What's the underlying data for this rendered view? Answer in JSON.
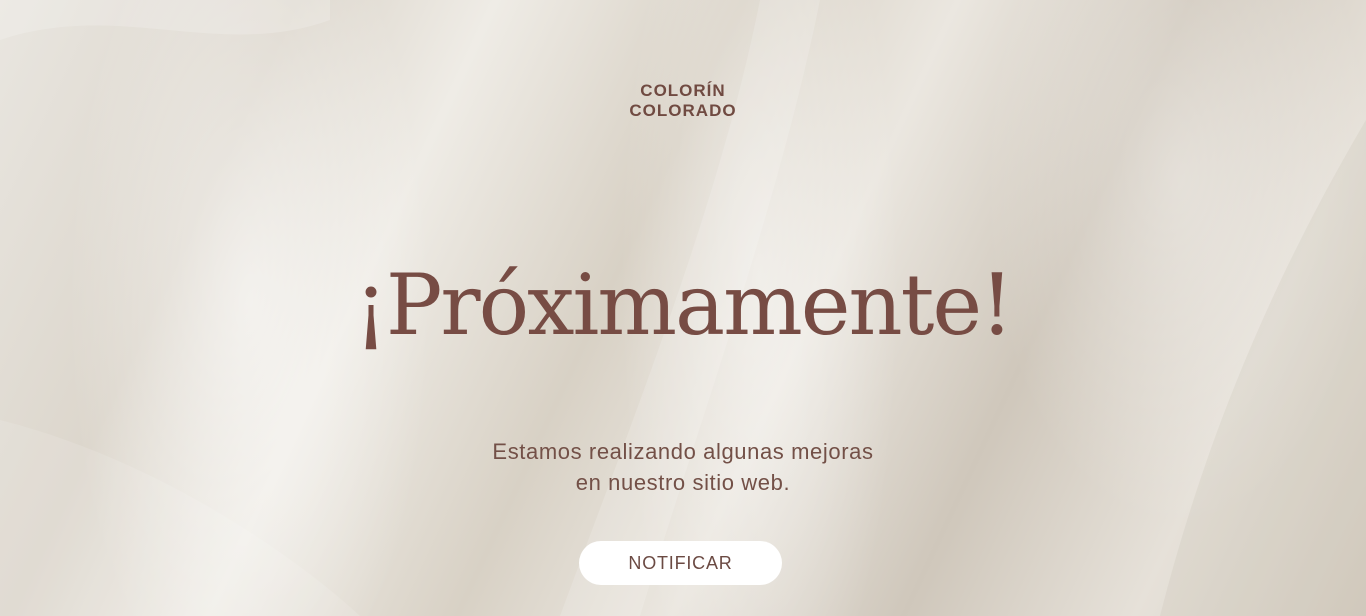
{
  "brand": {
    "line1": "COLORÍN",
    "line2": "COLORADO"
  },
  "hero": {
    "title": "¡Próximamente!",
    "subtitle_line1": "Estamos realizando algunas mejoras",
    "subtitle_line2": "en nuestro sitio web."
  },
  "cta": {
    "label": "NOTIFICAR"
  },
  "colors": {
    "accent": "#774c44",
    "background": "#e4dfd7",
    "button": "#ffffff"
  }
}
